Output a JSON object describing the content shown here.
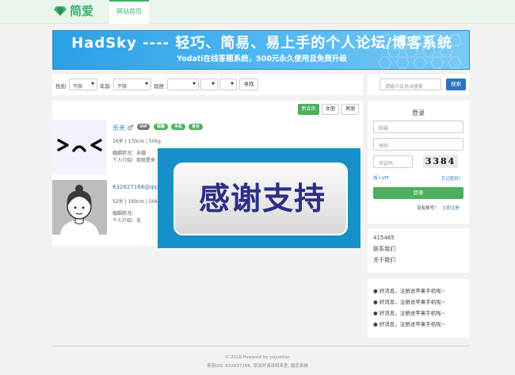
{
  "header": {
    "logo_text": "简爱",
    "nav_home": "网站首页",
    "brand_color": "#3db06c"
  },
  "banner": {
    "title": "HadSky ---- 轻巧、简易、易上手的个人论坛/博客系统",
    "subtitle": "Yodati在线答题系统，500元永久使用且免费升级"
  },
  "filter": {
    "gender_label": "性别",
    "gender_value": "不限",
    "age_label": "年龄",
    "age_value": "不限",
    "location_label": "现居",
    "location_values": [
      "",
      "",
      ""
    ],
    "search_label": "寻找"
  },
  "search": {
    "placeholder": "请输入会员id搜索",
    "button": "搜索"
  },
  "sort": {
    "new": "新会员",
    "female": "女朋",
    "male": "男朋"
  },
  "users": [
    {
      "name": "乐天",
      "gender_symbol": "♂",
      "badges": [
        "VIP",
        "邮箱",
        "手机",
        "身份"
      ],
      "stats": "16岁 | 170cm | 50kg",
      "marital": "婚姻状况：未婚",
      "intro": "个人介绍：我就是来"
    },
    {
      "name": "632827168@qq.c",
      "stats": "52岁 | 160cm | 50k",
      "marital": "婚姻状况：",
      "intro": "个人介绍：无"
    }
  ],
  "ad": {
    "text": "感谢支持"
  },
  "login": {
    "title": "登录",
    "email_placeholder": "邮箱",
    "password_placeholder": "密码",
    "captcha_placeholder": "验证码",
    "captcha_code": "3384",
    "join_vip": "加入VIP",
    "forgot": "忘记密码？",
    "submit": "登录",
    "no_account": "没有账号？",
    "register": "立即注册"
  },
  "stats": {
    "number": "415465",
    "contact": "联系我们",
    "about": "关于我们"
  },
  "news": {
    "items": [
      "好消息，注册送苹果手机啦~",
      "好消息，注册送苹果手机啦~",
      "好消息，注册送苹果手机啦~",
      "好消息，注册送苹果手机啦~"
    ]
  },
  "footer": {
    "line1": "© 2016 Powered by pojuetian",
    "line2": "客服QQ: 632827168, 添加时请说明来意, 婚恋系统"
  }
}
